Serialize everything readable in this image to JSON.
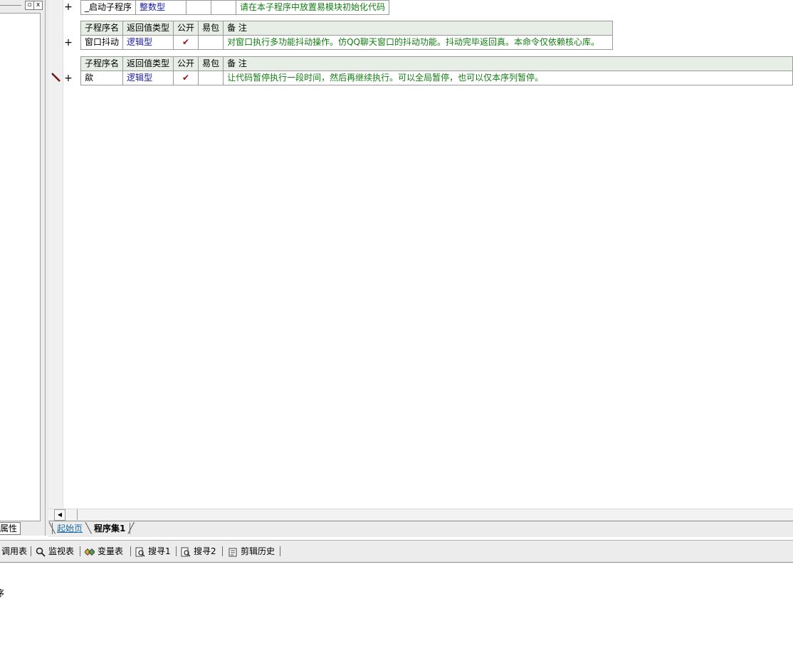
{
  "left_panel": {
    "tab_label": "属性",
    "restore_button": "▫",
    "close_button": "x"
  },
  "editor": {
    "rows": [
      {
        "name": "_启动子程序",
        "type": "整数型",
        "note": "请在本子程序中放置易模块初始化代码"
      }
    ],
    "headers": {
      "name": "子程序名",
      "return_type": "返回值类型",
      "public": "公开",
      "easy_pack": "易包",
      "note": "备 注"
    },
    "sub2": {
      "name": "窗口抖动",
      "type": "逻辑型",
      "public": "✔",
      "note": "对窗口执行多功能抖动操作。仿QQ聊天窗口的抖动功能。抖动完毕返回真。本命令仅依赖核心库。"
    },
    "sub3": {
      "name": "歘",
      "type": "逻辑型",
      "public": "✔",
      "note": "让代码暂停执行一段时间，然后再继续执行。可以全局暂停，也可以仅本序列暂停。"
    },
    "plus": "+"
  },
  "doc_tabs": {
    "start": "起始页",
    "program": "程序集1"
  },
  "bottom_bar": {
    "call_table": "调用表",
    "watch": "监视表",
    "variables": "变量表",
    "search1": "搜寻1",
    "search2": "搜寻2",
    "clip_history": "剪辑历史"
  },
  "output": {
    "text": "序"
  },
  "colors": {
    "header_bg": "#e6eee6",
    "type_text": "#1a1aa6",
    "note_text": "#107d10",
    "check": "#9b1010"
  }
}
